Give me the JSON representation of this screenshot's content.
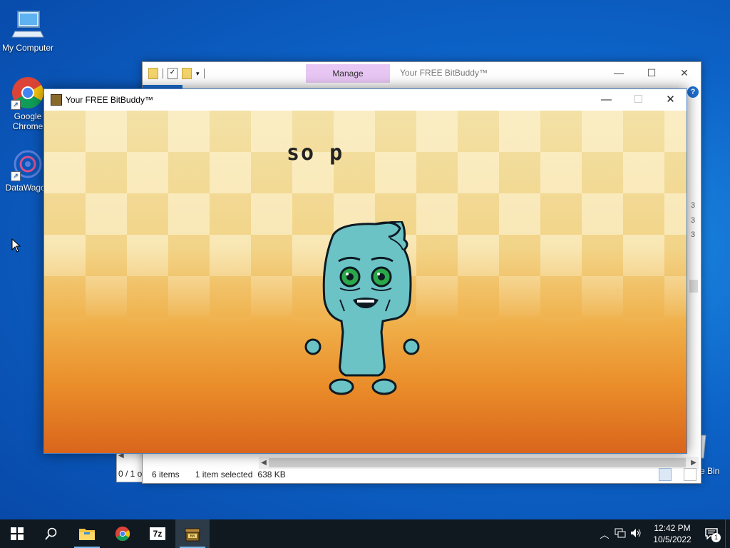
{
  "desktop": {
    "icons": [
      {
        "label": "My Computer"
      },
      {
        "label": "Google Chrome"
      },
      {
        "label": "DataWagon"
      }
    ],
    "recycle_bin_label_fragment": "e Bin"
  },
  "explorer": {
    "manage_tab": "Manage",
    "title": "Your FREE BitBuddy™",
    "status": {
      "items": "6 items",
      "selected": "1 item selected",
      "size": "638 KB"
    },
    "side_pane_text": "0 / 1 o",
    "right_column_fragments": [
      "3",
      "3",
      "3"
    ]
  },
  "bitbuddy": {
    "title": "Your FREE BitBuddy™",
    "speech_text": "so p",
    "colors": {
      "body": "#6cc3c6",
      "outline": "#0d1a22",
      "eyes": "#2aa84a"
    }
  },
  "taskbar": {
    "apps": [
      {
        "name": "file-explorer"
      },
      {
        "name": "google-chrome"
      },
      {
        "name": "7-zip",
        "label": "7z"
      },
      {
        "name": "bitbuddy"
      }
    ],
    "clock_time": "12:42 PM",
    "clock_date": "10/5/2022",
    "notification_count": "1"
  }
}
